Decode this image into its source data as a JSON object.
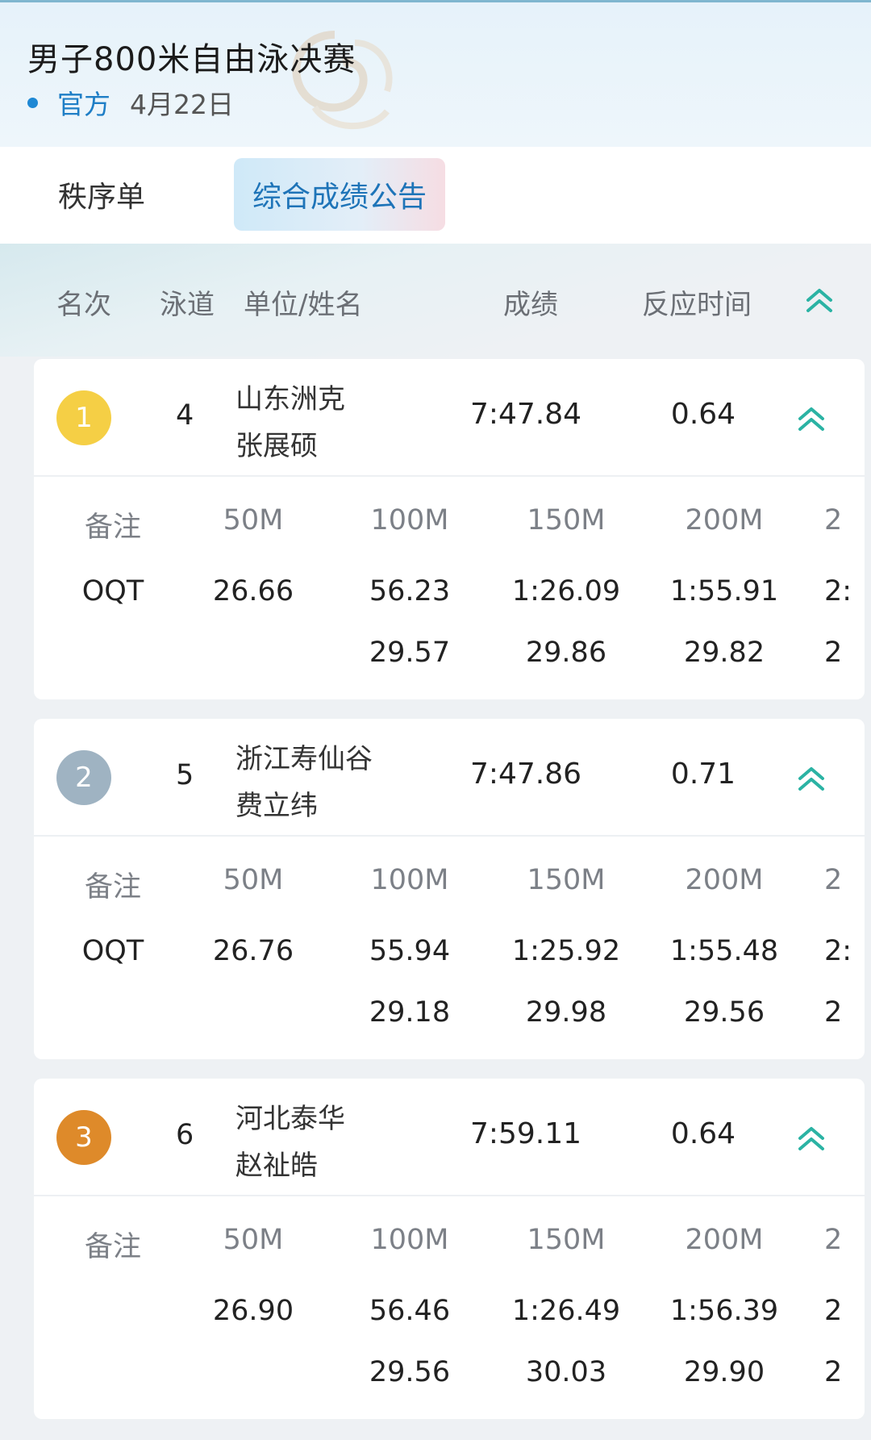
{
  "header": {
    "title": "男子800米自由泳决赛",
    "source": "官方",
    "date": "4月22日"
  },
  "tabs": [
    {
      "label": "秩序单"
    },
    {
      "label": "综合成绩公告"
    }
  ],
  "columns": {
    "rank": "名次",
    "lane": "泳道",
    "name": "单位/姓名",
    "score": "成绩",
    "reaction": "反应时间"
  },
  "split_headers": {
    "note": "备注",
    "d50": "50M",
    "d100": "100M",
    "d150": "150M",
    "d200": "200M",
    "d250": "2"
  },
  "results": [
    {
      "rank": "1",
      "lane": "4",
      "team": "山东洲克",
      "name": "张展硕",
      "score": "7:47.84",
      "reaction": "0.64",
      "medal_color": "#f5cf45",
      "note": "OQT",
      "splits": [
        "26.66",
        "56.23",
        "1:26.09",
        "1:55.91",
        "2:"
      ],
      "laps": [
        "",
        "29.57",
        "29.86",
        "29.82",
        "2"
      ]
    },
    {
      "rank": "2",
      "lane": "5",
      "team": "浙江寿仙谷",
      "name": "费立纬",
      "score": "7:47.86",
      "reaction": "0.71",
      "medal_color": "#9fb3c2",
      "note": "OQT",
      "splits": [
        "26.76",
        "55.94",
        "1:25.92",
        "1:55.48",
        "2:"
      ],
      "laps": [
        "",
        "29.18",
        "29.98",
        "29.56",
        "2"
      ]
    },
    {
      "rank": "3",
      "lane": "6",
      "team": "河北泰华",
      "name": "赵祉皓",
      "score": "7:59.11",
      "reaction": "0.64",
      "medal_color": "#de8a2a",
      "note": "",
      "splits": [
        "26.90",
        "56.46",
        "1:26.49",
        "1:56.39",
        "2"
      ],
      "laps": [
        "",
        "29.56",
        "30.03",
        "29.90",
        "2"
      ]
    }
  ],
  "colors": {
    "accent_teal": "#2bb3a4",
    "tab_active_text": "#1e74b8",
    "source_blue": "#1e7ec6"
  },
  "icons": {
    "collapse": "double-chevron-up-icon",
    "source_dot": "dot-icon"
  }
}
